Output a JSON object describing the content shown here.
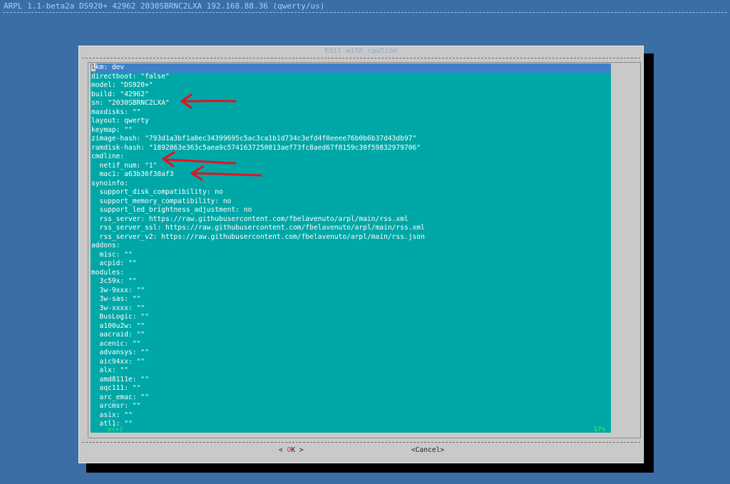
{
  "topbar": {
    "title": "ARPL 1.1-beta2a DS920+ 42962 2030SBRNC2LXA 192.168.88.36 (qwerty/us)"
  },
  "dialog": {
    "title": "Edit with caution",
    "cursor_char": "l",
    "first_line_rest": "km: dev",
    "lines": [
      "directboot: \"false\"",
      "model: \"DS920+\"",
      "build: \"42962\"",
      "sn: \"2030SBRNC2LXA\"",
      "maxdisks: \"\"",
      "layout: qwerty",
      "keymap: \"\"",
      "zimage-hash: \"793d1a3bf1a0ec34399695c5ac3ca1b1d734c3efd4f0eeee76b0b6b37d43db97\"",
      "ramdisk-hash: \"1892863e363c5aea9c5741637250813aef73fc8aed67f8159c30f59832979706\"",
      "cmdline:",
      "  netif_num: \"1\"",
      "  mac1: a63b36f38af3",
      "synoinfo:",
      "  support_disk_compatibility: no",
      "  support_memory_compatibility: no",
      "  support_led_brightness_adjustment: no",
      "  rss_server: https://raw.githubusercontent.com/fbelavenuto/arpl/main/rss.xml",
      "  rss_server_ssl: https://raw.githubusercontent.com/fbelavenuto/arpl/main/rss.xml",
      "  rss_server_v2: https://raw.githubusercontent.com/fbelavenuto/arpl/main/rss.json",
      "addons:",
      "  misc: \"\"",
      "  acpid: \"\"",
      "modules:",
      "  3c59x: \"\"",
      "  3w-9xxx: \"\"",
      "  3w-sas: \"\"",
      "  3w-xxxx: \"\"",
      "  BusLogic: \"\"",
      "  a100u2w: \"\"",
      "  aacraid: \"\"",
      "  acenic: \"\"",
      "  advansys: \"\"",
      "  aic94xx: \"\"",
      "  alx: \"\"",
      "  amd8111e: \"\"",
      "  aqc111: \"\"",
      "  arc_emac: \"\"",
      "  arcmsr: \"\"",
      "  asix: \"\"",
      "  atl1: \"\""
    ],
    "scroll_indicator": "v(+)",
    "scroll_percent": "17%",
    "ok_left": "< ",
    "ok_key": "O",
    "ok_rest": "K >",
    "cancel_label": "<Cancel>"
  },
  "colors": {
    "desktop": "#3a6ea5",
    "editor_bg": "#00a7a7",
    "annotation_arrow": "#e0141e"
  }
}
